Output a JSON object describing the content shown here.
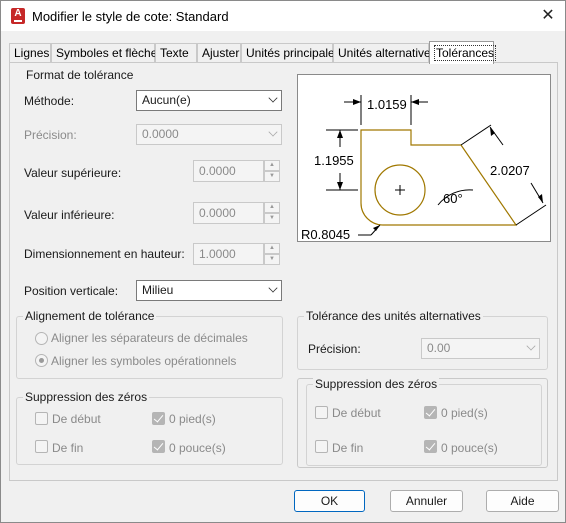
{
  "window": {
    "title": "Modifier le style de cote: Standard",
    "close_glyph": "✕"
  },
  "tabs": [
    {
      "label": "Lignes"
    },
    {
      "label": "Symboles et flèches"
    },
    {
      "label": "Texte"
    },
    {
      "label": "Ajuster"
    },
    {
      "label": "Unités principales"
    },
    {
      "label": "Unités alternatives"
    },
    {
      "label": "Tolérances",
      "active": true
    }
  ],
  "tolerance_format": {
    "title": "Format de tolérance",
    "method_label": "Méthode:",
    "method_value": "Aucun(e)",
    "precision_label": "Précision:",
    "precision_value": "0.0000",
    "upper_label": "Valeur supérieure:",
    "upper_value": "0.0000",
    "lower_label": "Valeur inférieure:",
    "lower_value": "0.0000",
    "height_label": "Dimensionnement en hauteur:",
    "height_value": "1.0000",
    "vertical_label": "Position verticale:",
    "vertical_value": "Milieu"
  },
  "alignment": {
    "title": "Alignement de tolérance",
    "option1": "Aligner les séparateurs de décimales",
    "option2": "Aligner les symboles opérationnels"
  },
  "zero_suppression": {
    "title": "Suppression des zéros",
    "leading": "De début",
    "trailing": "De fin",
    "feet": "0 pied(s)",
    "inches": "0 pouce(s)"
  },
  "alt_tolerance": {
    "title": "Tolérance des unités alternatives",
    "precision_label": "Précision:",
    "precision_value": "0.00"
  },
  "alt_zero_suppression": {
    "title": "Suppression des zéros",
    "leading": "De début",
    "trailing": "De fin",
    "feet": "0 pied(s)",
    "inches": "0 pouce(s)"
  },
  "preview": {
    "dim_top": "1.0159",
    "dim_left": "1.1955",
    "dim_right": "2.0207",
    "angle": "60°",
    "radius": "R0.8045"
  },
  "buttons": {
    "ok": "OK",
    "cancel": "Annuler",
    "help": "Aide"
  },
  "colors": {
    "accent": "#0067c0",
    "part_outline": "#a07800",
    "brand_icon": "#c62828"
  }
}
